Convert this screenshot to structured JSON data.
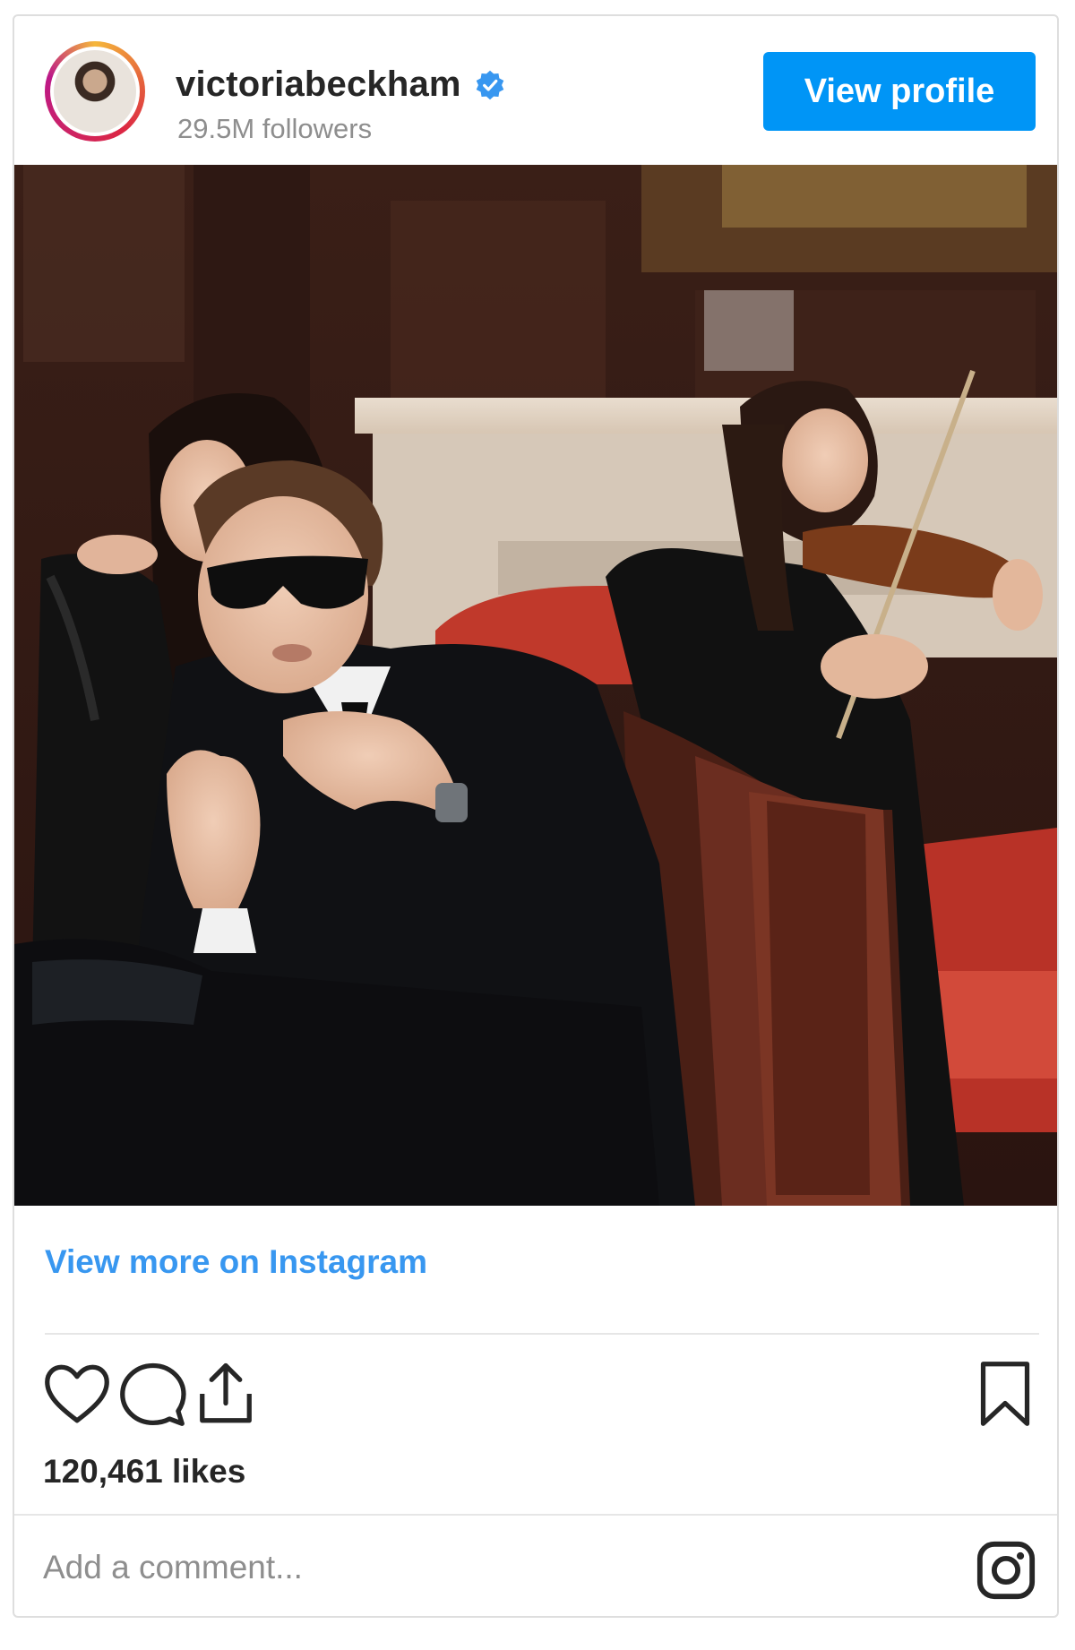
{
  "header": {
    "username": "victoriabeckham",
    "followers": "29.5M followers",
    "view_profile_label": "View profile"
  },
  "post": {
    "view_more_label": "View more on Instagram",
    "likes": "120,461 likes",
    "comment_placeholder": "Add a comment..."
  },
  "icons": {
    "verified": "verified-badge-icon",
    "like": "heart-icon",
    "comment": "speech-bubble-icon",
    "share": "share-upload-icon",
    "save": "bookmark-icon",
    "brand": "instagram-icon"
  },
  "colors": {
    "accent": "#0095f6",
    "link": "#3897f0",
    "text": "#262626",
    "muted": "#8e8e8e"
  }
}
